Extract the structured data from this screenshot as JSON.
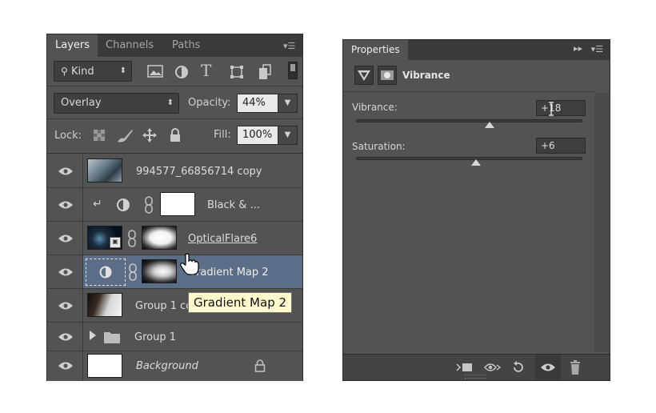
{
  "layers_panel": {
    "tabs": [
      {
        "label": "Layers",
        "active": true
      },
      {
        "label": "Channels",
        "active": false
      },
      {
        "label": "Paths",
        "active": false
      }
    ],
    "filter": {
      "label": "Kind"
    },
    "blend_mode": "Overlay",
    "opacity_label": "Opacity:",
    "opacity_value": "44%",
    "lock_label": "Lock:",
    "fill_label": "Fill:",
    "fill_value": "100%",
    "layers": [
      {
        "name": "994577_66856714 copy",
        "selected": false
      },
      {
        "name": "Black & ...",
        "selected": false
      },
      {
        "name": "OpticalFlare6",
        "selected": false
      },
      {
        "name": "Gradient Map 2",
        "selected": true
      },
      {
        "name": "Group 1 co",
        "selected": false
      },
      {
        "name": "Group 1",
        "selected": false
      },
      {
        "name": "Background",
        "selected": false
      }
    ]
  },
  "tooltip": "Gradient Map 2",
  "properties_panel": {
    "tab": "Properties",
    "adjustment_title": "Vibrance",
    "vibrance_label": "Vibrance:",
    "vibrance_value": "+18",
    "vibrance_level": 0.59,
    "saturation_label": "Saturation:",
    "saturation_value": "+6",
    "saturation_level": 0.53
  },
  "colors": {
    "panel_bg": "#535353",
    "tab_bar": "#3a3a3a",
    "selected_row": "#5c6e87",
    "tooltip_bg": "#fffbcd"
  }
}
